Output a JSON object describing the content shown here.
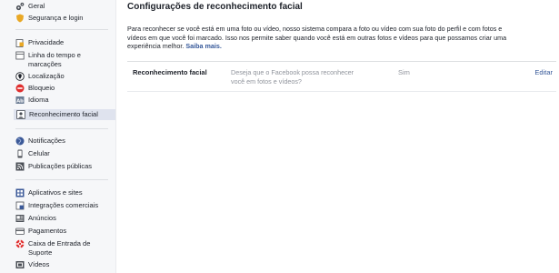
{
  "sidebar": {
    "groups": [
      [
        {
          "label": "Geral",
          "icon": "gears-icon"
        },
        {
          "label": "Segurança e login",
          "icon": "shield-icon"
        }
      ],
      [
        {
          "label": "Privacidade",
          "icon": "privacy-lock-icon"
        },
        {
          "label": "Linha do tempo e marcações",
          "icon": "timeline-icon"
        },
        {
          "label": "Localização",
          "icon": "location-icon"
        },
        {
          "label": "Bloqueio",
          "icon": "block-icon"
        },
        {
          "label": "Idioma",
          "icon": "language-icon"
        },
        {
          "label": "Reconhecimento facial",
          "icon": "face-recognition-icon",
          "active": true
        }
      ],
      [
        {
          "label": "Notificações",
          "icon": "globe-icon"
        },
        {
          "label": "Celular",
          "icon": "mobile-icon"
        },
        {
          "label": "Publicações públicas",
          "icon": "rss-icon"
        }
      ],
      [
        {
          "label": "Aplicativos e sites",
          "icon": "apps-icon"
        },
        {
          "label": "Integrações comerciais",
          "icon": "business-icon"
        },
        {
          "label": "Anúncios",
          "icon": "ads-icon"
        },
        {
          "label": "Pagamentos",
          "icon": "payments-icon"
        },
        {
          "label": "Caixa de Entrada de Suporte",
          "icon": "support-icon"
        },
        {
          "label": "Vídeos",
          "icon": "video-icon"
        }
      ]
    ]
  },
  "main": {
    "title": "Configurações de reconhecimento facial",
    "description_lines": [
      "Para reconhecer se você está em uma foto ou vídeo, nosso sistema compara a foto ou vídeo com sua foto do perfil e com fotos e",
      "vídeos em que você foi marcado. Isso nos permite saber quando você está em outras fotos e vídeos para que possamos criar uma",
      "experiência melhor."
    ],
    "learn_more": "Saiba mais.",
    "setting": {
      "label": "Reconhecimento facial",
      "question": "Deseja que o Facebook possa reconhecer você em fotos e vídeos?",
      "value": "Sim",
      "edit": "Editar"
    }
  },
  "colors": {
    "link": "#365899",
    "active_bg": "#dfe3ee",
    "sidebar_bg": "#f6f7f9",
    "muted_text": "#90949c"
  }
}
